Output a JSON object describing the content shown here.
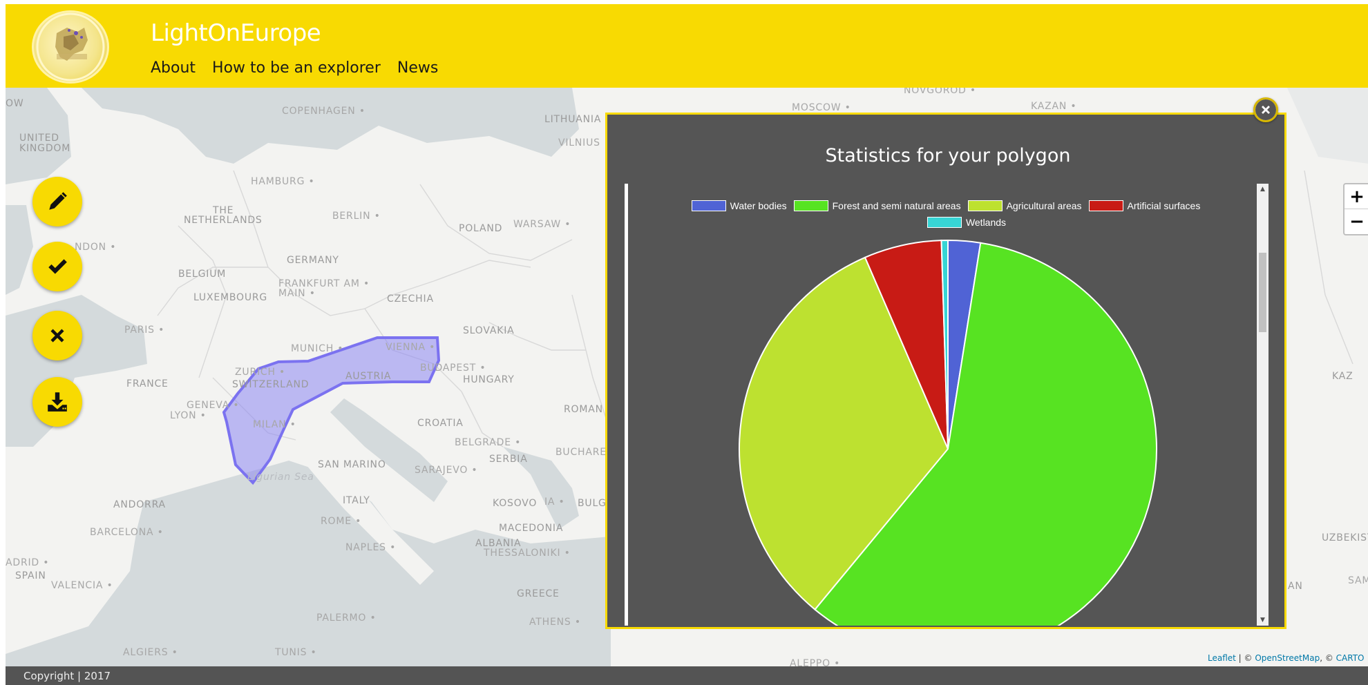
{
  "header": {
    "title": "LightOnEurope",
    "nav": [
      "About",
      "How to be an explorer",
      "News"
    ]
  },
  "map": {
    "labels": [
      {
        "t": "OW",
        "k": "c"
      },
      {
        "t": "UNITED",
        "k": "c"
      },
      {
        "t": "KINGDOM",
        "k": "c"
      },
      {
        "t": "COPENHAGEN",
        "k": "p"
      },
      {
        "t": "LITHUANIA",
        "k": "c"
      },
      {
        "t": "VILNIUS",
        "k": "p"
      },
      {
        "t": "MOSCOW",
        "k": "p"
      },
      {
        "t": "NOVGOROD",
        "k": "p"
      },
      {
        "t": "KAZAN",
        "k": "p"
      },
      {
        "t": "HAMBURG",
        "k": "p"
      },
      {
        "t": "THE",
        "k": "c"
      },
      {
        "t": "NETHERLANDS",
        "k": "c"
      },
      {
        "t": "BERLIN",
        "k": "p"
      },
      {
        "t": "POLAND",
        "k": "c"
      },
      {
        "t": "WARSAW",
        "k": "p"
      },
      {
        "t": "NDON",
        "k": "p"
      },
      {
        "t": "GERMANY",
        "k": "c"
      },
      {
        "t": "BELGIUM",
        "k": "c"
      },
      {
        "t": "FRANKFURT AM",
        "k": "p"
      },
      {
        "t": "MAIN",
        "k": "p"
      },
      {
        "t": "LUXEMBOURG",
        "k": "c"
      },
      {
        "t": "CZECHIA",
        "k": "c"
      },
      {
        "t": "PARIS",
        "k": "p"
      },
      {
        "t": "SLOVAKIA",
        "k": "c"
      },
      {
        "t": "MUNICH",
        "k": "p"
      },
      {
        "t": "VIENNA",
        "k": "p"
      },
      {
        "t": "ZURICH",
        "k": "p"
      },
      {
        "t": "AUSTRIA",
        "k": "c"
      },
      {
        "t": "BUDAPEST",
        "k": "p"
      },
      {
        "t": "FRANCE",
        "k": "c"
      },
      {
        "t": "SWITZERLAND",
        "k": "c"
      },
      {
        "t": "HUNGARY",
        "k": "c"
      },
      {
        "t": "GENEVA",
        "k": "p"
      },
      {
        "t": "LYON",
        "k": "p"
      },
      {
        "t": "MILAN",
        "k": "p"
      },
      {
        "t": "CROATIA",
        "k": "c"
      },
      {
        "t": "ROMAN",
        "k": "c"
      },
      {
        "t": "BELGRADE",
        "k": "p"
      },
      {
        "t": "SERBIA",
        "k": "c"
      },
      {
        "t": "BUCHARE",
        "k": "p"
      },
      {
        "t": "SAN MARINO",
        "k": "c"
      },
      {
        "t": "SARAJEVO",
        "k": "p"
      },
      {
        "t": "Ligurian Sea",
        "k": "s"
      },
      {
        "t": "ANDORRA",
        "k": "c"
      },
      {
        "t": "ITALY",
        "k": "c"
      },
      {
        "t": "KOSOVO",
        "k": "c"
      },
      {
        "t": "IA",
        "k": "p"
      },
      {
        "t": "BULG",
        "k": "c"
      },
      {
        "t": "ROME",
        "k": "p"
      },
      {
        "t": "BARCELONA",
        "k": "p"
      },
      {
        "t": "MACEDONIA",
        "k": "c"
      },
      {
        "t": "NAPLES",
        "k": "p"
      },
      {
        "t": "ALBANIA",
        "k": "c"
      },
      {
        "t": "THESSALONIKI",
        "k": "p"
      },
      {
        "t": "ADRID",
        "k": "p"
      },
      {
        "t": "SPAIN",
        "k": "c"
      },
      {
        "t": "VALENCIA",
        "k": "p"
      },
      {
        "t": "GREECE",
        "k": "c"
      },
      {
        "t": "PALERMO",
        "k": "p"
      },
      {
        "t": "ATHENS",
        "k": "p"
      },
      {
        "t": "ALGIERS",
        "k": "p"
      },
      {
        "t": "TUNIS",
        "k": "p"
      },
      {
        "t": "ALEPPO",
        "k": "p"
      },
      {
        "t": "KAZ",
        "k": "c"
      },
      {
        "t": "UZBEKIST",
        "k": "c"
      },
      {
        "t": "AN",
        "k": "c"
      },
      {
        "t": "SAM",
        "k": "p"
      }
    ],
    "polygon_color": "#7b72f0",
    "zoom_in": "+",
    "zoom_out": "−",
    "attribution": {
      "leaflet": "Leaflet",
      "sep1": " | © ",
      "osm": "OpenStreetMap",
      "sep2": ", © ",
      "carto": "CARTO"
    }
  },
  "tools": [
    {
      "name": "draw-polygon-button",
      "icon": "pencil-icon"
    },
    {
      "name": "confirm-button",
      "icon": "check-icon"
    },
    {
      "name": "clear-button",
      "icon": "x-icon"
    },
    {
      "name": "download-button",
      "icon": "download-icon"
    }
  ],
  "popup": {
    "title": "Statistics for your polygon",
    "close_icon": "close-icon"
  },
  "chart_data": {
    "type": "pie",
    "title": "",
    "series": [
      {
        "name": "Water bodies",
        "value": 2.5,
        "color": "#5063d5"
      },
      {
        "name": "Forest and semi natural areas",
        "value": 58.5,
        "color": "#57e322"
      },
      {
        "name": "Agricultural areas",
        "value": 32.5,
        "color": "#bde130"
      },
      {
        "name": "Artificial surfaces",
        "value": 6.0,
        "color": "#c81b15"
      },
      {
        "name": "Wetlands",
        "value": 0.5,
        "color": "#37d5d5"
      }
    ],
    "legend": "top"
  },
  "footer": {
    "copyright": "Copyright | 2017"
  }
}
